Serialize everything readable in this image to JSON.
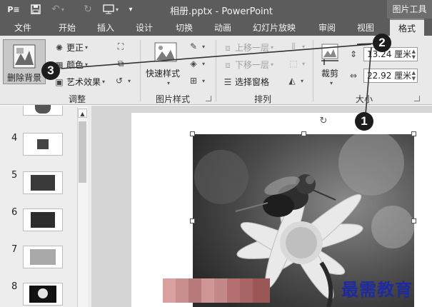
{
  "title_bar": {
    "doc_title": "相册.pptx - PowerPoint",
    "context_header": "图片工具",
    "qa_icons": [
      "app-icon",
      "save-icon",
      "undo-icon",
      "redo-icon",
      "slideshow-icon"
    ]
  },
  "tabs": [
    "文件",
    "开始",
    "插入",
    "设计",
    "切换",
    "动画",
    "幻灯片放映",
    "审阅",
    "视图",
    "格式"
  ],
  "active_tab": "格式",
  "ribbon": {
    "adjust": {
      "remove_bg": "删除背景",
      "corrections": "更正",
      "color": "颜色",
      "artistic": "艺术效果",
      "group": "调整"
    },
    "picture_styles": {
      "quick_styles": "快速样式",
      "group": "图片样式"
    },
    "arrange": {
      "bring_forward": "上移一层",
      "send_backward": "下移一层",
      "selection_pane": "选择窗格",
      "group": "排列"
    },
    "size": {
      "crop": "裁剪",
      "height": "13.24 厘米",
      "width": "22.92 厘米",
      "group": "大小"
    }
  },
  "slides": [
    {
      "num": "4"
    },
    {
      "num": "5"
    },
    {
      "num": "6"
    },
    {
      "num": "7"
    },
    {
      "num": "8"
    }
  ],
  "callouts": [
    "1",
    "2",
    "3"
  ],
  "watermark": "最需教育"
}
